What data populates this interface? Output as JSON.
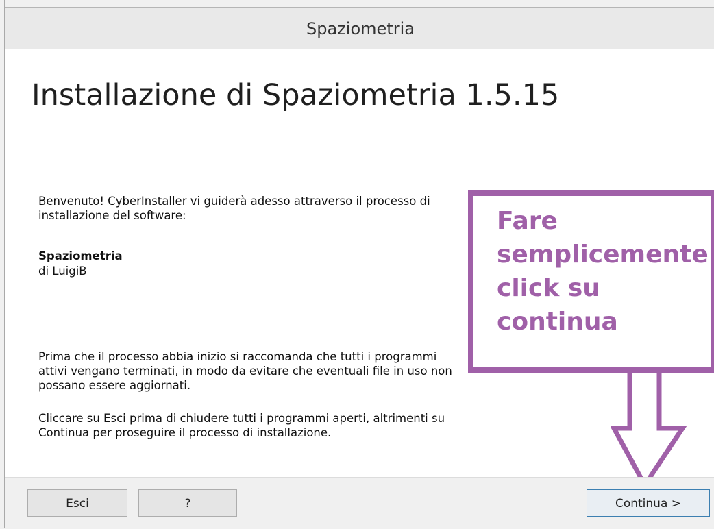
{
  "window": {
    "title": "Spaziometria"
  },
  "main": {
    "heading": "Installazione di Spaziometria 1.5.15",
    "welcome": "Benvenuto! CyberInstaller vi guiderà adesso attraverso il processo di installazione del software:",
    "app_name": "Spaziometria",
    "author": "di LuigiB",
    "warning": "Prima che il processo abbia inizio si raccomanda che tutti i programmi attivi vengano terminati, in modo da evitare che eventuali file in uso non possano essere aggiornati.",
    "instructions": "Cliccare su Esci prima di chiudere tutti i programmi aperti, altrimenti su Continua per proseguire il processo di installazione."
  },
  "annotation": {
    "text": "Fare semplicemente click su continua",
    "color": "#a060a8",
    "icon": "down-arrow-icon"
  },
  "footer": {
    "exit_label": "Esci",
    "help_label": "?",
    "continue_label": "Continua >"
  }
}
